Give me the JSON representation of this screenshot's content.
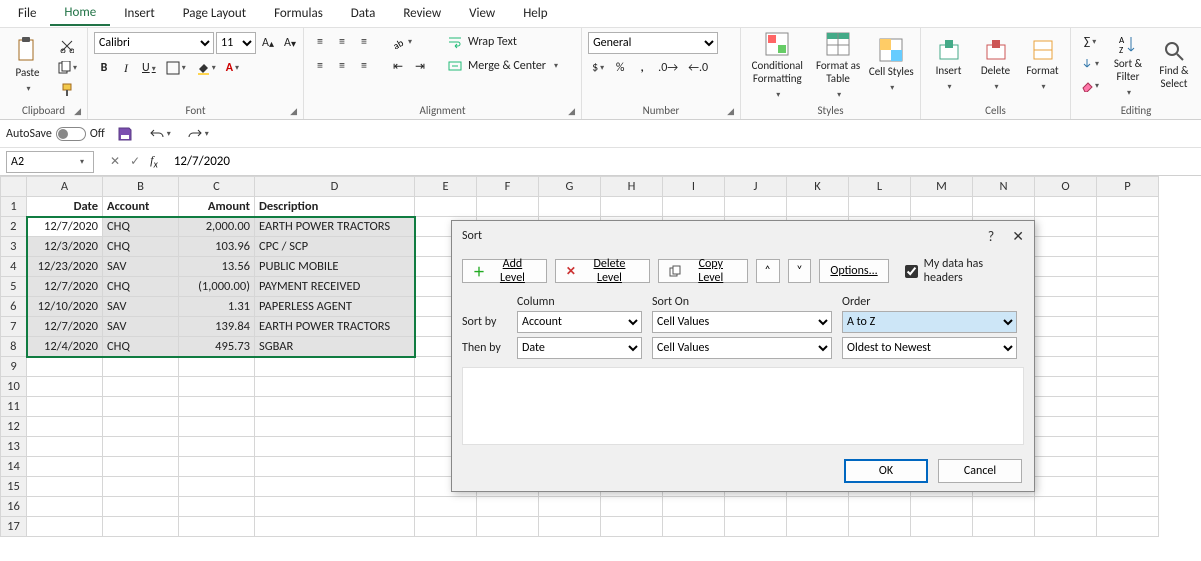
{
  "menu": {
    "items": [
      "File",
      "Home",
      "Insert",
      "Page Layout",
      "Formulas",
      "Data",
      "Review",
      "View",
      "Help"
    ],
    "active": 1
  },
  "ribbon": {
    "clipboard": {
      "label": "Clipboard",
      "paste": "Paste"
    },
    "font": {
      "label": "Font",
      "name": "Calibri",
      "size": "11"
    },
    "alignment": {
      "label": "Alignment",
      "wrap": "Wrap Text",
      "merge": "Merge & Center"
    },
    "number": {
      "label": "Number",
      "format": "General"
    },
    "styles": {
      "label": "Styles",
      "cond": "Conditional Formatting",
      "table": "Format as Table",
      "cell": "Cell Styles"
    },
    "cells": {
      "label": "Cells",
      "insert": "Insert",
      "delete": "Delete",
      "format": "Format"
    },
    "editing": {
      "label": "Editing",
      "sort": "Sort & Filter",
      "find": "Find & Select"
    }
  },
  "qat": {
    "autosave": "AutoSave",
    "state": "Off"
  },
  "namebox": "A2",
  "formula": "12/7/2020",
  "chart_data": {
    "type": "table",
    "title": "",
    "columns": [
      "Date",
      "Account",
      "Amount",
      "Description"
    ],
    "rows": [
      {
        "Date": "12/7/2020",
        "Account": "CHQ",
        "Amount": 2000.0,
        "Description": "EARTH POWER TRACTORS"
      },
      {
        "Date": "12/3/2020",
        "Account": "CHQ",
        "Amount": 103.96,
        "Description": "CPC / SCP"
      },
      {
        "Date": "12/23/2020",
        "Account": "SAV",
        "Amount": 13.56,
        "Description": "PUBLIC MOBILE"
      },
      {
        "Date": "12/7/2020",
        "Account": "CHQ",
        "Amount": -1000.0,
        "Description": "PAYMENT RECEIVED"
      },
      {
        "Date": "12/10/2020",
        "Account": "SAV",
        "Amount": 1.31,
        "Description": "PAPERLESS AGENT"
      },
      {
        "Date": "12/7/2020",
        "Account": "SAV",
        "Amount": 139.84,
        "Description": "EARTH POWER TRACTORS"
      },
      {
        "Date": "12/4/2020",
        "Account": "CHQ",
        "Amount": 495.73,
        "Description": "SGBAR"
      }
    ]
  },
  "sheet": {
    "cols": [
      "A",
      "B",
      "C",
      "D",
      "E",
      "F",
      "G",
      "H",
      "I",
      "J",
      "K",
      "L",
      "M",
      "N",
      "O",
      "P"
    ],
    "headers": {
      "A": "Date",
      "B": "Account",
      "C": "Amount",
      "D": "Description"
    },
    "rows": [
      {
        "A": "12/7/2020",
        "B": "CHQ",
        "C": "2,000.00",
        "D": "EARTH POWER TRACTORS"
      },
      {
        "A": "12/3/2020",
        "B": "CHQ",
        "C": "103.96",
        "D": "CPC / SCP"
      },
      {
        "A": "12/23/2020",
        "B": "SAV",
        "C": "13.56",
        "D": "PUBLIC MOBILE"
      },
      {
        "A": "12/7/2020",
        "B": "CHQ",
        "C": "(1,000.00)",
        "D": "PAYMENT RECEIVED"
      },
      {
        "A": "12/10/2020",
        "B": "SAV",
        "C": "1.31",
        "D": "PAPERLESS AGENT"
      },
      {
        "A": "12/7/2020",
        "B": "SAV",
        "C": "139.84",
        "D": "EARTH POWER TRACTORS"
      },
      {
        "A": "12/4/2020",
        "B": "CHQ",
        "C": "495.73",
        "D": "SGBAR"
      }
    ],
    "blank_rows": 9
  },
  "dialog": {
    "title": "Sort",
    "add": "Add Level",
    "del": "Delete Level",
    "copy": "Copy Level",
    "opts": "Options...",
    "headers_chk": "My data has headers",
    "headers_checked": true,
    "col_h": {
      "c": "Column",
      "s": "Sort On",
      "o": "Order"
    },
    "levels": [
      {
        "label": "Sort by",
        "column": "Account",
        "on": "Cell Values",
        "order": "A to Z",
        "hi": true
      },
      {
        "label": "Then by",
        "column": "Date",
        "on": "Cell Values",
        "order": "Oldest to Newest",
        "hi": false
      }
    ],
    "ok": "OK",
    "cancel": "Cancel"
  }
}
